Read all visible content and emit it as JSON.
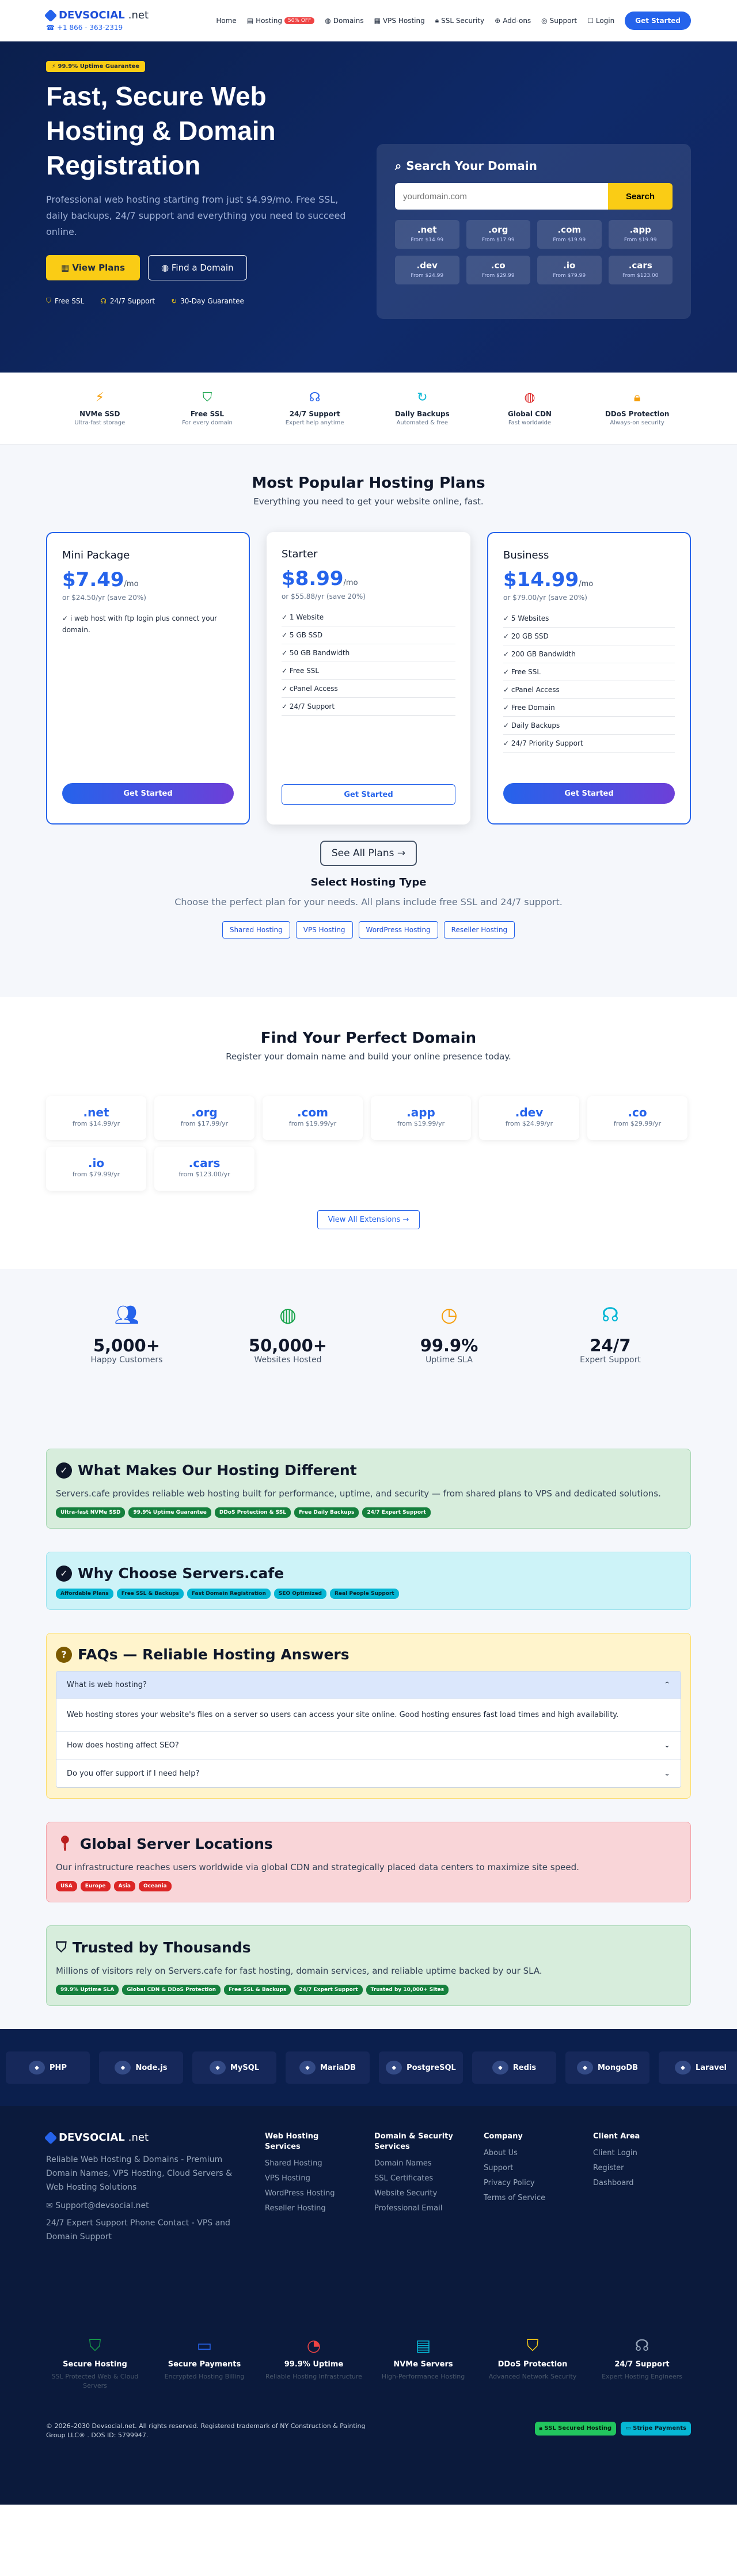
{
  "brand": {
    "name": "DEVSOCIAL",
    "suffix": ".net",
    "phone": "+1 866 - 363-2319"
  },
  "nav": [
    {
      "label": "Home",
      "icon": ""
    },
    {
      "label": "Hosting",
      "icon": "server-icon",
      "badge": "50% OFF"
    },
    {
      "label": "Domains",
      "icon": "globe-icon"
    },
    {
      "label": "VPS Hosting",
      "icon": "vps-icon"
    },
    {
      "label": "SSL Security",
      "icon": "lock-icon"
    },
    {
      "label": "Add-ons",
      "icon": "plus-icon"
    },
    {
      "label": "Support",
      "icon": "support-icon"
    },
    {
      "label": "Login",
      "icon": "user-icon"
    }
  ],
  "nav_cta": "Get Started",
  "hero": {
    "badge": "99.9% Uptime Guarantee",
    "title": "Fast, Secure Web Hosting & Domain Registration",
    "lead": "Professional web hosting starting from just $4.99/mo. Free SSL, daily backups, 24/7 support and everything you need to succeed online.",
    "btn_plans": "View Plans",
    "btn_domain": "Find a Domain",
    "features": [
      "Free SSL",
      "24/7 Support",
      "30-Day Guarantee"
    ]
  },
  "search": {
    "title": "Search Your Domain",
    "placeholder": "yourdomain.com",
    "button": "Search",
    "extensions": [
      {
        "ext": ".net",
        "price": "From $14.99"
      },
      {
        "ext": ".org",
        "price": "From $17.99"
      },
      {
        "ext": ".com",
        "price": "From $19.99"
      },
      {
        "ext": ".app",
        "price": "From $19.99"
      },
      {
        "ext": ".dev",
        "price": "From $24.99"
      },
      {
        "ext": ".co",
        "price": "From $29.99"
      },
      {
        "ext": ".io",
        "price": "From $79.99"
      },
      {
        "ext": ".cars",
        "price": "From $123.00"
      }
    ]
  },
  "strip": [
    {
      "title": "NVMe SSD",
      "sub": "Ultra-fast storage",
      "icon": "bolt-icon",
      "color": "#f59e0b"
    },
    {
      "title": "Free SSL",
      "sub": "For every domain",
      "icon": "shield-icon",
      "color": "#16a34a"
    },
    {
      "title": "24/7 Support",
      "sub": "Expert help anytime",
      "icon": "headset-icon",
      "color": "#2563eb"
    },
    {
      "title": "Daily Backups",
      "sub": "Automated & free",
      "icon": "refresh-icon",
      "color": "#06b6d4"
    },
    {
      "title": "Global CDN",
      "sub": "Fast worldwide",
      "icon": "globe-icon",
      "color": "#dc2626"
    },
    {
      "title": "DDoS Protection",
      "sub": "Always-on security",
      "icon": "lock-icon",
      "color": "#f59e0b"
    }
  ],
  "plans_section": {
    "title": "Most Popular Hosting Plans",
    "sub": "Everything you need to get your website online, fast."
  },
  "plans": [
    {
      "name": "Mini Package",
      "price": "$7.49",
      "per": "/mo",
      "yearly": "or $24.50/yr (save 20%)",
      "features": [
        "✓ i web host with ftp login plus connect your domain."
      ],
      "cta": "Get Started"
    },
    {
      "name": "Starter",
      "price": "$8.99",
      "per": "/mo",
      "yearly": "or $55.88/yr (save 20%)",
      "features": [
        "✓ 1 Website",
        "✓ 5 GB SSD",
        "✓ 50 GB Bandwidth",
        "✓ Free SSL",
        "✓ cPanel Access",
        "✓ 24/7 Support"
      ],
      "cta": "Get Started"
    },
    {
      "name": "Business",
      "price": "$14.99",
      "per": "/mo",
      "yearly": "or $79.00/yr (save 20%)",
      "features": [
        "✓ 5 Websites",
        "✓ 20 GB SSD",
        "✓ 200 GB Bandwidth",
        "✓ Free SSL",
        "✓ cPanel Access",
        "✓ Free Domain",
        "✓ Daily Backups",
        "✓ 24/7 Priority Support"
      ],
      "cta": "Get Started"
    }
  ],
  "see_all": "See All Plans →",
  "hosting_type": {
    "title": "Select Hosting Type",
    "sub": "Choose the perfect plan for your needs. All plans include free SSL and 24/7 support.",
    "chips": [
      "Shared Hosting",
      "VPS Hosting",
      "WordPress Hosting",
      "Reseller Hosting"
    ]
  },
  "domains_section": {
    "title": "Find Your Perfect Domain",
    "sub": "Register your domain name and build your online presence today.",
    "cards": [
      {
        "ext": ".net",
        "price": "from $14.99/yr"
      },
      {
        "ext": ".org",
        "price": "from $17.99/yr"
      },
      {
        "ext": ".com",
        "price": "from $19.99/yr"
      },
      {
        "ext": ".app",
        "price": "from $19.99/yr"
      },
      {
        "ext": ".dev",
        "price": "from $24.99/yr"
      },
      {
        "ext": ".co",
        "price": "from $29.99/yr"
      },
      {
        "ext": ".io",
        "price": "from $79.99/yr"
      },
      {
        "ext": ".cars",
        "price": "from $123.00/yr"
      }
    ],
    "view_all": "View All Extensions →"
  },
  "stats": [
    {
      "value": "5,000+",
      "label": "Happy Customers",
      "icon": "users-icon",
      "color": "#2563eb"
    },
    {
      "value": "50,000+",
      "label": "Websites Hosted",
      "icon": "globe-icon",
      "color": "#16a34a"
    },
    {
      "value": "99.9%",
      "label": "Uptime SLA",
      "icon": "clock-icon",
      "color": "#f59e0b"
    },
    {
      "value": "24/7",
      "label": "Expert Support",
      "icon": "headset-icon",
      "color": "#06b6d4"
    }
  ],
  "diff": {
    "title": "What Makes Our Hosting Different",
    "text": "Servers.cafe provides reliable web hosting built for performance, uptime, and security — from shared plans to VPS and dedicated solutions.",
    "tags": [
      "Ultra-fast NVMe SSD",
      "99.9% Uptime Guarantee",
      "DDoS Protection & SSL",
      "Free Daily Backups",
      "24/7 Expert Support"
    ]
  },
  "why": {
    "title": "Why Choose Servers.cafe",
    "tags": [
      "Affordable Plans",
      "Free SSL & Backups",
      "Fast Domain Registration",
      "SEO Optimized",
      "Real People Support"
    ]
  },
  "faqs": {
    "title": "FAQs — Reliable Hosting Answers",
    "items": [
      {
        "q": "What is web hosting?",
        "a": "Web hosting stores your website's files on a server so users can access your site online. Good hosting ensures fast load times and high availability."
      },
      {
        "q": "How does hosting affect SEO?"
      },
      {
        "q": "Do you offer support if I need help?"
      }
    ]
  },
  "locations": {
    "title": "Global Server Locations",
    "text": "Our infrastructure reaches users worldwide via global CDN and strategically placed data centers to maximize site speed.",
    "tags": [
      "USA",
      "Europe",
      "Asia",
      "Oceania"
    ]
  },
  "trusted": {
    "title": "Trusted by Thousands",
    "text": "Millions of visitors rely on Servers.cafe for fast hosting, domain services, and reliable uptime backed by our SLA.",
    "tags": [
      "99.9% Uptime SLA",
      "Global CDN & DDoS Protection",
      "Free SSL & Backups",
      "24/7 Expert Support",
      "Trusted by 10,000+ Sites"
    ]
  },
  "tech": [
    {
      "name": "PHP",
      "icon": "php-icon"
    },
    {
      "name": "Node.js",
      "icon": "nodejs-icon"
    },
    {
      "name": "MySQL",
      "icon": "mysql-icon"
    },
    {
      "name": "MariaDB",
      "icon": "mariadb-icon"
    },
    {
      "name": "PostgreSQL",
      "icon": "postgresql-icon"
    },
    {
      "name": "Redis",
      "icon": "redis-icon"
    },
    {
      "name": "MongoDB",
      "icon": "mongodb-icon"
    },
    {
      "name": "Laravel",
      "icon": "laravel-icon"
    }
  ],
  "footer": {
    "tagline": "Reliable Web Hosting & Domains - Premium Domain Names, VPS Hosting, Cloud Servers & Web Hosting Solutions",
    "email": "Support@devsocial.net",
    "contact": "24/7 Expert Support Phone Contact - VPS and Domain Support",
    "cols": [
      {
        "title": "Web Hosting Services",
        "links": [
          "Shared Hosting",
          "VPS Hosting",
          "WordPress Hosting",
          "Reseller Hosting"
        ]
      },
      {
        "title": "Domain & Security Services",
        "links": [
          "Domain Names",
          "SSL Certificates",
          "Website Security",
          "Professional Email"
        ]
      },
      {
        "title": "Company",
        "links": [
          "About Us",
          "Support",
          "Privacy Policy",
          "Terms of Service"
        ]
      },
      {
        "title": "Client Area",
        "links": [
          "Client Login",
          "Register",
          "Dashboard"
        ]
      }
    ],
    "trust": [
      {
        "title": "Secure Hosting",
        "sub": "SSL Protected Web & Cloud Servers",
        "icon": "shield-icon",
        "color": "#16a34a"
      },
      {
        "title": "Secure Payments",
        "sub": "Encrypted Hosting Billing",
        "icon": "card-icon",
        "color": "#2563eb"
      },
      {
        "title": "99.9% Uptime",
        "sub": "Reliable Hosting Infrastructure",
        "icon": "gauge-icon",
        "color": "#ef4444"
      },
      {
        "title": "NVMe Servers",
        "sub": "High-Performance Hosting",
        "icon": "server-icon",
        "color": "#06b6d4"
      },
      {
        "title": "DDoS Protection",
        "sub": "Advanced Network Security",
        "icon": "shield-check-icon",
        "color": "#facc15"
      },
      {
        "title": "24/7 Support",
        "sub": "Expert Hosting Engineers",
        "icon": "headset-icon",
        "color": "#94a3b8"
      }
    ],
    "copyright": "© 2026–2030 Devsocial.net. All rights reserved. Registered trademark of NY Construction & Painting Group LLC® . DOS ID: 5799947.",
    "badges": [
      "SSL Secured Hosting",
      "Stripe Payments"
    ]
  }
}
